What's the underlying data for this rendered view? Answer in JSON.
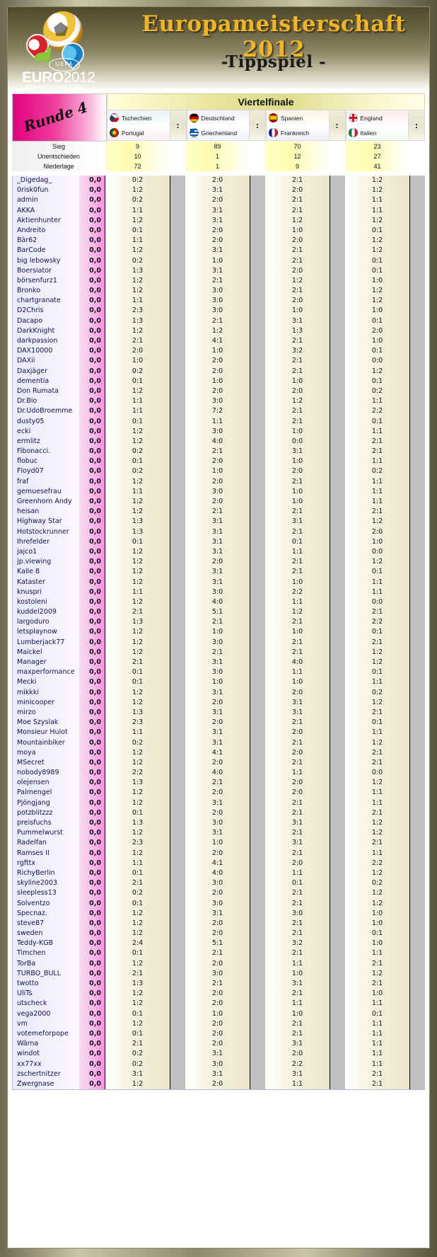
{
  "banner": {
    "title": "Europameisterschaft 2012",
    "subtitle": "-Tippspiel -",
    "logo": {
      "euro_text": "EURO",
      "euro_year": "2012",
      "uefa": "UEFA",
      "country": "POLAND-UKRAINE"
    }
  },
  "round": {
    "badge": "Runde 4",
    "stage_title": "Viertelfinale"
  },
  "matches": [
    {
      "home": "Tschechien",
      "away": "Portugal",
      "home_flag": "czech-republic-flag",
      "away_flag": "portugal-flag",
      "separator": ":"
    },
    {
      "home": "Deutschland",
      "away": "Griechenland",
      "home_flag": "germany-flag",
      "away_flag": "greece-flag",
      "separator": ":"
    },
    {
      "home": "Spanien",
      "away": "Frankreich",
      "home_flag": "spain-flag",
      "away_flag": "france-flag",
      "separator": ":"
    },
    {
      "home": "England",
      "away": "Italien",
      "home_flag": "england-flag",
      "away_flag": "italy-flag",
      "separator": ":"
    }
  ],
  "stats": [
    {
      "label": "Sieg",
      "values": [
        "9",
        "89",
        "70",
        "23"
      ]
    },
    {
      "label": "Unentschieden",
      "values": [
        "10",
        "1",
        "12",
        "27"
      ]
    },
    {
      "label": "Niederlage",
      "values": [
        "72",
        "1",
        "9",
        "41"
      ]
    }
  ],
  "tips": [
    {
      "name": "_Digedag_",
      "points": "0,0",
      "scores": [
        "0:2",
        "2:0",
        "2:1",
        "1:2"
      ]
    },
    {
      "name": "0risk0fun",
      "points": "0,0",
      "scores": [
        "1:2",
        "3:1",
        "2:0",
        "1:2"
      ]
    },
    {
      "name": "admin",
      "points": "0,0",
      "scores": [
        "0:2",
        "2:0",
        "2:1",
        "1:1"
      ]
    },
    {
      "name": "AKKA",
      "points": "0,0",
      "scores": [
        "1:1",
        "3:1",
        "2:1",
        "1:1"
      ]
    },
    {
      "name": "Aktienhunter",
      "points": "0,0",
      "scores": [
        "1:2",
        "3:1",
        "1:2",
        "1:2"
      ]
    },
    {
      "name": "Andreito",
      "points": "0,0",
      "scores": [
        "0:1",
        "2:0",
        "1:0",
        "0:1"
      ]
    },
    {
      "name": "Bär62",
      "points": "0,0",
      "scores": [
        "1:1",
        "2:0",
        "2:0",
        "1:2"
      ]
    },
    {
      "name": "BarCode",
      "points": "0,0",
      "scores": [
        "1:2",
        "3:1",
        "2:1",
        "1:2"
      ]
    },
    {
      "name": "big lebowsky",
      "points": "0,0",
      "scores": [
        "0:2",
        "1:0",
        "2:1",
        "0:1"
      ]
    },
    {
      "name": "Boersiator",
      "points": "0,0",
      "scores": [
        "1:3",
        "3:1",
        "2:0",
        "0:1"
      ]
    },
    {
      "name": "börsenfurz1",
      "points": "0,0",
      "scores": [
        "1:2",
        "2:1",
        "1:2",
        "1:0"
      ]
    },
    {
      "name": "Bronko",
      "points": "0,0",
      "scores": [
        "1:2",
        "3:0",
        "2:1",
        "1:2"
      ]
    },
    {
      "name": "chartgranate",
      "points": "0,0",
      "scores": [
        "1:1",
        "3:0",
        "2:0",
        "1:2"
      ]
    },
    {
      "name": "D2Chris",
      "points": "0,0",
      "scores": [
        "2:3",
        "3:0",
        "1:0",
        "1:0"
      ]
    },
    {
      "name": "Dacapo",
      "points": "0,0",
      "scores": [
        "1:3",
        "2:1",
        "3:1",
        "0:1"
      ]
    },
    {
      "name": "DarkKnight",
      "points": "0,0",
      "scores": [
        "1:2",
        "1:2",
        "1:3",
        "2:0"
      ]
    },
    {
      "name": "darkpassion",
      "points": "0,0",
      "scores": [
        "2:1",
        "4:1",
        "2:1",
        "1:0"
      ]
    },
    {
      "name": "DAX10000",
      "points": "0,0",
      "scores": [
        "2:0",
        "1:0",
        "3:2",
        "0:1"
      ]
    },
    {
      "name": "DAXii",
      "points": "0,0",
      "scores": [
        "1:0",
        "2:0",
        "2:1",
        "0:0"
      ]
    },
    {
      "name": "Daxjäger",
      "points": "0,0",
      "scores": [
        "0:2",
        "2:0",
        "2:1",
        "1:2"
      ]
    },
    {
      "name": "dementia",
      "points": "0,0",
      "scores": [
        "0:1",
        "1:0",
        "1:0",
        "0:1"
      ]
    },
    {
      "name": "Don Rumata",
      "points": "0,0",
      "scores": [
        "1:2",
        "2:0",
        "2:0",
        "0:2"
      ]
    },
    {
      "name": "Dr.Bio",
      "points": "0,0",
      "scores": [
        "1:1",
        "3:0",
        "1:2",
        "1:1"
      ]
    },
    {
      "name": "Dr.UdoBroemme",
      "points": "0,0",
      "scores": [
        "1:1",
        "7:2",
        "2:1",
        "2:2"
      ]
    },
    {
      "name": "dusty05",
      "points": "0,0",
      "scores": [
        "0:1",
        "1:1",
        "2:1",
        "0:1"
      ]
    },
    {
      "name": "ecki",
      "points": "0,0",
      "scores": [
        "1:2",
        "3:0",
        "1:0",
        "1:1"
      ]
    },
    {
      "name": "ermlitz",
      "points": "0,0",
      "scores": [
        "1:2",
        "4:0",
        "0:0",
        "2:1"
      ]
    },
    {
      "name": "Fibonacci.",
      "points": "0,0",
      "scores": [
        "0:2",
        "2:1",
        "3:1",
        "2:1"
      ]
    },
    {
      "name": "flobuc",
      "points": "0,0",
      "scores": [
        "0:1",
        "2:0",
        "1:0",
        "1:1"
      ]
    },
    {
      "name": "Floyd07",
      "points": "0,0",
      "scores": [
        "0:2",
        "1:0",
        "2:0",
        "0:2"
      ]
    },
    {
      "name": "fraf",
      "points": "0,0",
      "scores": [
        "1:2",
        "2:0",
        "2:1",
        "1:1"
      ]
    },
    {
      "name": "gemuesefrau",
      "points": "0,0",
      "scores": [
        "1:1",
        "3:0",
        "1:0",
        "1:1"
      ]
    },
    {
      "name": "Greenhorn Andy",
      "points": "0,0",
      "scores": [
        "1:2",
        "2:0",
        "1:0",
        "1:1"
      ]
    },
    {
      "name": "heisan",
      "points": "0,0",
      "scores": [
        "1:2",
        "2:1",
        "2:1",
        "2:1"
      ]
    },
    {
      "name": "Highway Star",
      "points": "0,0",
      "scores": [
        "1:3",
        "3:1",
        "3:1",
        "1:2"
      ]
    },
    {
      "name": "Hotstockrunner",
      "points": "0,0",
      "scores": [
        "1:3",
        "3:1",
        "2:1",
        "2:0"
      ]
    },
    {
      "name": "Ihrefelder",
      "points": "0,0",
      "scores": [
        "0:1",
        "3:1",
        "0:1",
        "1:0"
      ]
    },
    {
      "name": "jajco1",
      "points": "0,0",
      "scores": [
        "1:2",
        "3:1",
        "1:1",
        "0:0"
      ]
    },
    {
      "name": "jp.viewing",
      "points": "0,0",
      "scores": [
        "1:2",
        "2:0",
        "2:1",
        "1:2"
      ]
    },
    {
      "name": "Kalle 8",
      "points": "0,0",
      "scores": [
        "1:2",
        "3:1",
        "2:1",
        "0:1"
      ]
    },
    {
      "name": "Kataster",
      "points": "0,0",
      "scores": [
        "1:2",
        "3:1",
        "1:0",
        "1:1"
      ]
    },
    {
      "name": "knuspri",
      "points": "0,0",
      "scores": [
        "1:1",
        "3:0",
        "2:2",
        "1:1"
      ]
    },
    {
      "name": "kostoleni",
      "points": "0,0",
      "scores": [
        "1:2",
        "4:0",
        "1:1",
        "0:0"
      ]
    },
    {
      "name": "kuddel2009",
      "points": "0,0",
      "scores": [
        "2:1",
        "5:1",
        "1:2",
        "2:1"
      ]
    },
    {
      "name": "largoduro",
      "points": "0,0",
      "scores": [
        "1:3",
        "2:1",
        "2:1",
        "2:2"
      ]
    },
    {
      "name": "letsplaynow",
      "points": "0,0",
      "scores": [
        "1:2",
        "1:0",
        "1:0",
        "0:1"
      ]
    },
    {
      "name": "Lumberjack77",
      "points": "0,0",
      "scores": [
        "1:2",
        "3:0",
        "2:1",
        "2:1"
      ]
    },
    {
      "name": "Maickel",
      "points": "0,0",
      "scores": [
        "1:2",
        "2:1",
        "2:1",
        "1:2"
      ]
    },
    {
      "name": "Manager",
      "points": "0,0",
      "scores": [
        "2:1",
        "3:1",
        "4:0",
        "1:2"
      ]
    },
    {
      "name": "maxperformance",
      "points": "0,0",
      "scores": [
        "0:1",
        "3:0",
        "1:1",
        "0:1"
      ]
    },
    {
      "name": "Mecki",
      "points": "0,0",
      "scores": [
        "0:1",
        "1:0",
        "1:0",
        "1:1"
      ]
    },
    {
      "name": "mikkki",
      "points": "0,0",
      "scores": [
        "1:2",
        "3:1",
        "2:0",
        "0:2"
      ]
    },
    {
      "name": "minicooper",
      "points": "0,0",
      "scores": [
        "1:2",
        "2:0",
        "3:1",
        "1:2"
      ]
    },
    {
      "name": "mirzo",
      "points": "0,0",
      "scores": [
        "1:3",
        "3:1",
        "3:1",
        "2:1"
      ]
    },
    {
      "name": "Moe Szyslak",
      "points": "0,0",
      "scores": [
        "2:3",
        "2:0",
        "2:1",
        "0:1"
      ]
    },
    {
      "name": "Monsieur Hulot",
      "points": "0,0",
      "scores": [
        "1:1",
        "3:1",
        "2:0",
        "1:1"
      ]
    },
    {
      "name": "Mountainbiker",
      "points": "0,0",
      "scores": [
        "0:2",
        "3:1",
        "2:1",
        "1:2"
      ]
    },
    {
      "name": "moya",
      "points": "0,0",
      "scores": [
        "1:2",
        "4:1",
        "2:0",
        "2:1"
      ]
    },
    {
      "name": "MSecret",
      "points": "0,0",
      "scores": [
        "1:2",
        "2:0",
        "2:1",
        "2:1"
      ]
    },
    {
      "name": "nobody8989",
      "points": "0,0",
      "scores": [
        "2:2",
        "4:0",
        "1:1",
        "0:0"
      ]
    },
    {
      "name": "olejensen",
      "points": "0,0",
      "scores": [
        "1:3",
        "2:1",
        "2:0",
        "1:2"
      ]
    },
    {
      "name": "Palmengel",
      "points": "0,0",
      "scores": [
        "1:2",
        "2:0",
        "2:0",
        "1:1"
      ]
    },
    {
      "name": "Pjöngjang",
      "points": "0,0",
      "scores": [
        "1:2",
        "3:1",
        "2:1",
        "1:1"
      ]
    },
    {
      "name": "potzblitzzz",
      "points": "0,0",
      "scores": [
        "0:1",
        "2:0",
        "2:1",
        "2:1"
      ]
    },
    {
      "name": "preisfuchs",
      "points": "0,0",
      "scores": [
        "1:3",
        "3:0",
        "3:1",
        "1:2"
      ]
    },
    {
      "name": "Pummelwurst",
      "points": "0,0",
      "scores": [
        "1:2",
        "3:1",
        "2:1",
        "1:2"
      ]
    },
    {
      "name": "Radelfan",
      "points": "0,0",
      "scores": [
        "2:3",
        "1:0",
        "3:1",
        "2:1"
      ]
    },
    {
      "name": "Ramses II",
      "points": "0,0",
      "scores": [
        "1:2",
        "2:0",
        "2:1",
        "1:1"
      ]
    },
    {
      "name": "rgfttx",
      "points": "0,0",
      "scores": [
        "1:1",
        "4:1",
        "2:0",
        "2:2"
      ]
    },
    {
      "name": "RichyBerlin",
      "points": "0,0",
      "scores": [
        "0:1",
        "4:0",
        "1:1",
        "1:2"
      ]
    },
    {
      "name": "skyline2003",
      "points": "0,0",
      "scores": [
        "2:1",
        "3:0",
        "0:1",
        "0:2"
      ]
    },
    {
      "name": "sleepless13",
      "points": "0,0",
      "scores": [
        "0:2",
        "2:0",
        "2:1",
        "1:2"
      ]
    },
    {
      "name": "Solventzo",
      "points": "0,0",
      "scores": [
        "0:1",
        "3:0",
        "2:1",
        "1:2"
      ]
    },
    {
      "name": "Specnaz.",
      "points": "0,0",
      "scores": [
        "1:2",
        "3:1",
        "3:0",
        "1:0"
      ]
    },
    {
      "name": "steve87",
      "points": "0,0",
      "scores": [
        "1:2",
        "2:0",
        "2:1",
        "1:0"
      ]
    },
    {
      "name": "sweden",
      "points": "0,0",
      "scores": [
        "1:2",
        "2:0",
        "2:1",
        "0:1"
      ]
    },
    {
      "name": "Teddy-KGB",
      "points": "0,0",
      "scores": [
        "2:4",
        "5:1",
        "3:2",
        "1:0"
      ]
    },
    {
      "name": "Timchen",
      "points": "0,0",
      "scores": [
        "0:1",
        "2:1",
        "2:1",
        "1:1"
      ]
    },
    {
      "name": "TorBa",
      "points": "0,0",
      "scores": [
        "1:2",
        "2:0",
        "1:1",
        "2:1"
      ]
    },
    {
      "name": "TURBO_BULL",
      "points": "0,0",
      "scores": [
        "2:1",
        "3:0",
        "1:0",
        "1:2"
      ]
    },
    {
      "name": "twotto",
      "points": "0,0",
      "scores": [
        "1:3",
        "2:1",
        "3:1",
        "2:1"
      ]
    },
    {
      "name": "UliTs",
      "points": "0,0",
      "scores": [
        "1:2",
        "2:0",
        "2:1",
        "1:0"
      ]
    },
    {
      "name": "utscheck",
      "points": "0,0",
      "scores": [
        "1:2",
        "2:0",
        "1:1",
        "1:1"
      ]
    },
    {
      "name": "vega2000",
      "points": "0,0",
      "scores": [
        "0:1",
        "1:0",
        "1:0",
        "0:1"
      ]
    },
    {
      "name": "vm",
      "points": "0,0",
      "scores": [
        "1:2",
        "2:0",
        "2:1",
        "1:1"
      ]
    },
    {
      "name": "votemeforpope",
      "points": "0,0",
      "scores": [
        "0:1",
        "2:0",
        "2:1",
        "1:1"
      ]
    },
    {
      "name": "Wärna",
      "points": "0,0",
      "scores": [
        "2:1",
        "2:0",
        "3:1",
        "1:1"
      ]
    },
    {
      "name": "windot",
      "points": "0,0",
      "scores": [
        "0:2",
        "3:1",
        "2:0",
        "1:1"
      ]
    },
    {
      "name": "xx77xx",
      "points": "0,0",
      "scores": [
        "0:2",
        "3:0",
        "2:2",
        "1:1"
      ]
    },
    {
      "name": "zschertnitzer",
      "points": "0,0",
      "scores": [
        "3:1",
        "3:1",
        "3:1",
        "2:1"
      ]
    },
    {
      "name": "Zwergnase",
      "points": "0,0",
      "scores": [
        "1:2",
        "2:0",
        "1:1",
        "2:1"
      ]
    }
  ]
}
